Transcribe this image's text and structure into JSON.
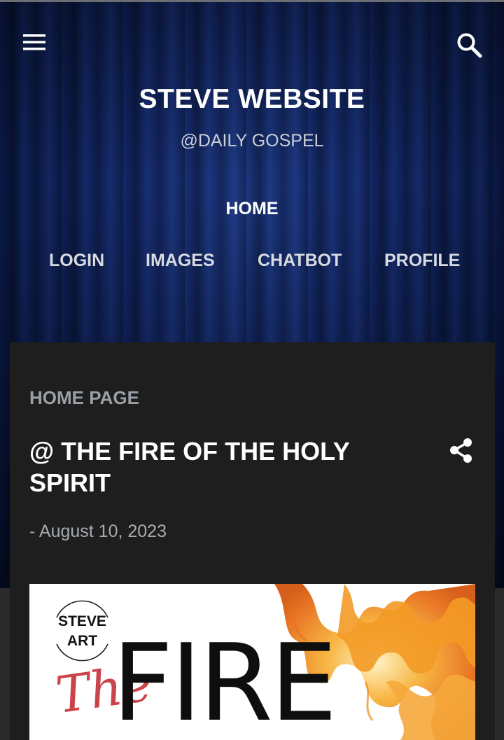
{
  "header": {
    "site_title": "STEVE WEBSITE",
    "site_subtitle": "@DAILY GOSPEL",
    "menu_icon": "hamburger-menu-icon",
    "search_icon": "search-icon",
    "nav": {
      "home": "HOME",
      "items": [
        "LOGIN",
        "IMAGES",
        "CHATBOT",
        "PROFILE"
      ]
    }
  },
  "post": {
    "section_label": "HOME PAGE",
    "title": "@ THE FIRE OF THE HOLY SPIRIT",
    "date": "- August 10, 2023",
    "share_icon": "share-icon",
    "image": {
      "logo_line1": "STEVE",
      "logo_line2": "ART",
      "script_word": "The",
      "big_word": "FIRE"
    }
  },
  "colors": {
    "header_blue": "#13286a",
    "card_bg": "#1e1e1e",
    "accent_red": "#c4242c",
    "flame_orange": "#f08a1c"
  }
}
